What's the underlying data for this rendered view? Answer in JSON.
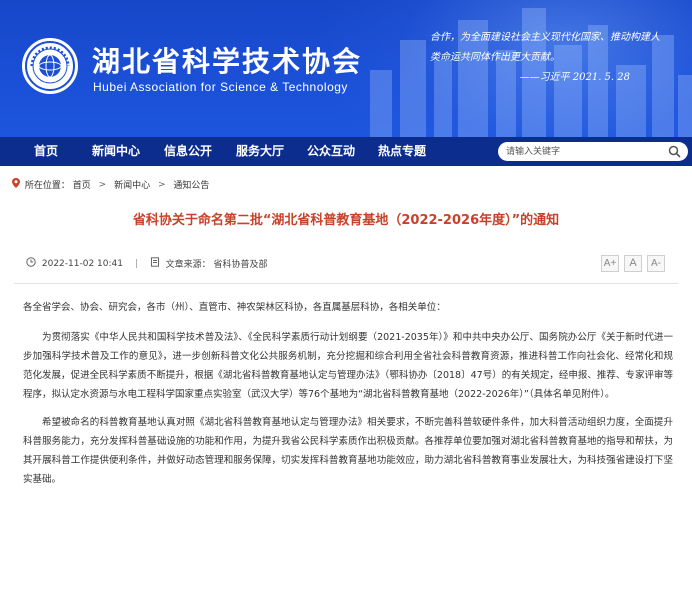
{
  "header": {
    "org_name_cn": "湖北省科学技术协会",
    "org_name_en": "Hubei Association for Science & Technology",
    "quote_lines": [
      "合作，为全面建设社会主义现代化国家、推动构建人",
      "类命运共同体作出更大贡献。"
    ],
    "quote_signature": "——习近平  2021. 5. 28",
    "logo_icon": "hast-emblem-icon"
  },
  "nav": {
    "items": [
      "首页",
      "新闻中心",
      "信息公开",
      "服务大厅",
      "公众互动",
      "热点专题"
    ],
    "search_placeholder": "请输入关键字",
    "search_icon": "search-icon"
  },
  "breadcrumb": {
    "prefix": "所在位置：",
    "items": [
      "首页",
      "新闻中心",
      "通知公告"
    ],
    "separator": ">"
  },
  "article": {
    "title": "省科协关于命名第二批“湖北省科普教育基地（2022-2026年度）”的通知",
    "datetime": "2022-11-02 10:41",
    "meta_divider": "|",
    "source_label": "文章来源：",
    "source": "省科协普及部",
    "font_size_buttons": [
      "A+",
      "A",
      "A-"
    ],
    "salutation": "各全省学会、协会、研究会，各市（州）、直管市、神农架林区科协，各直属基层科协，各相关单位：",
    "paragraphs": [
      "为贯彻落实《中华人民共和国科学技术普及法》、《全民科学素质行动计划纲要（2021-2035年）》和中共中央办公厅、国务院办公厅《关于新时代进一步加强科学技术普及工作的意见》，进一步创新科普文化公共服务机制，充分挖掘和综合利用全省社会科普教育资源，推进科普工作向社会化、经常化和规范化发展，促进全民科学素质不断提升，根据《湖北省科普教育基地认定与管理办法》（鄂科协办〔2018〕47号）的有关规定，经申报、推荐、专家评审等程序，拟认定水资源与水电工程科学国家重点实验室（武汉大学）等76个基地为“湖北省科普教育基地（2022-2026年）”（具体名单见附件）。",
      "希望被命名的科普教育基地认真对照《湖北省科普教育基地认定与管理办法》相关要求，不断完善科普软硬件条件，加大科普活动组织力度，全面提升科普服务能力，充分发挥科普基础设施的功能和作用，为提升我省公民科学素质作出积极贡献。各推荐单位要加强对湖北省科普教育基地的指导和帮扶，为其开展科普工作提供便利条件，并做好动态管理和服务保障，切实发挥科普教育基地功能效应，助力湖北省科普教育事业发展壮大，为科技强省建设打下坚实基础。"
    ]
  },
  "colors": {
    "banner_blue": "#1a4fd6",
    "nav_navy": "#0c2d8e",
    "title_red": "#c8422a"
  }
}
